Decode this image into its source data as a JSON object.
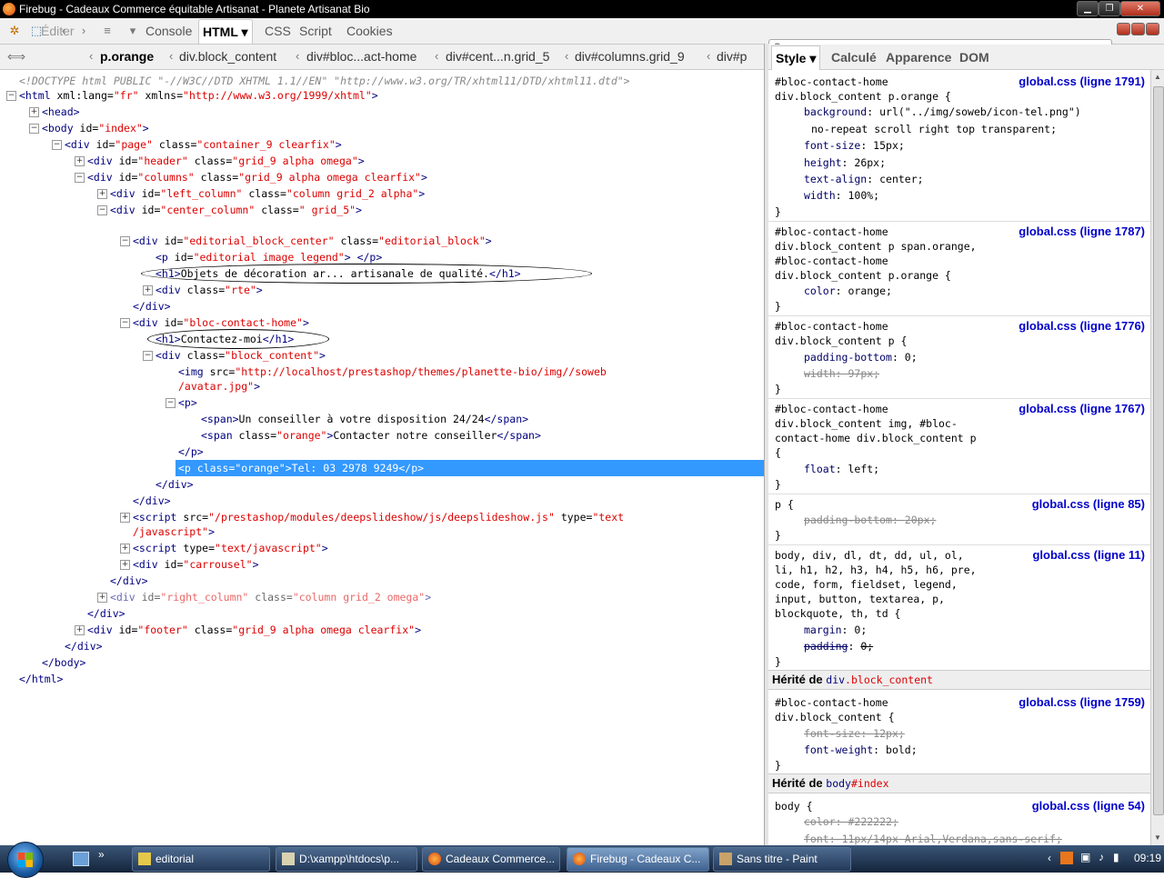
{
  "window": {
    "title": "Firebug - Cadeaux Commerce équitable Artisanat - Planete Artisanat Bio"
  },
  "toolbar": {
    "tabs": [
      {
        "label": "Éditer"
      },
      {
        "label": "Console"
      },
      {
        "label": "HTML ▾"
      },
      {
        "label": "CSS"
      },
      {
        "label": "Script"
      },
      {
        "label": "Cookies"
      }
    ]
  },
  "breadcrumb": [
    "p.orange",
    "div.block_content",
    "div#bloc...act-home",
    "div#cent...n.grid_5",
    "div#columns.grid_9",
    "div#p"
  ],
  "html": {
    "doctype": "<!DOCTYPE html PUBLIC \"-//W3C//DTD XHTML 1.1//EN\" \"http://www.w3.org/TR/xhtml11/DTD/xhtml11.dtd\">",
    "lines": [
      [
        "<html ",
        "xml:lang=",
        "\"fr\"",
        " xmlns=",
        "\"http://www.w3.org/1999/xhtml\"",
        ">"
      ],
      [
        "<head>"
      ],
      [
        "<body ",
        "id=",
        "\"index\"",
        ">"
      ],
      [
        "<div ",
        "id=",
        "\"page\"",
        " class=",
        "\"container_9 clearfix\"",
        ">"
      ],
      [
        "<div ",
        "id=",
        "\"header\"",
        " class=",
        "\"grid_9 alpha omega\"",
        ">"
      ],
      [
        "<div ",
        "id=",
        "\"columns\"",
        " class=",
        "\"grid_9 alpha omega clearfix\"",
        ">"
      ],
      [
        "<div ",
        "id=",
        "\"left_column\"",
        " class=",
        "\"column grid_2 alpha\"",
        ">"
      ],
      [
        "<div ",
        "id=",
        "\"center_column\"",
        " class=",
        "\" grid_5\"",
        ">"
      ],
      [
        "<div ",
        "id=",
        "\"editorial_block_center\"",
        " class=",
        "\"editorial_block\"",
        ">"
      ],
      [
        "<p ",
        "id=",
        "\"editorial image legend\"",
        ">  </p>"
      ],
      [
        "<h1>",
        "Objets de décoration ar... artisanale de qualité.",
        "</h1>"
      ],
      [
        "<div ",
        "class=",
        "\"rte\"",
        ">"
      ],
      [
        "</div>"
      ],
      [
        "<div ",
        "id=",
        "\"bloc-contact-home\"",
        ">"
      ],
      [
        "<h1>",
        "Contactez-moi",
        "</h1>"
      ],
      [
        "<div ",
        "class=",
        "\"block_content\"",
        ">"
      ],
      [
        "<img ",
        "src=",
        "\"http://localhost/prestashop/themes/planette-bio/img//soweb"
      ],
      [
        "/avatar.jpg\"",
        ">"
      ],
      [
        "<p>"
      ],
      [
        "<span>",
        "Un conseiller à votre disposition 24/24",
        "</span>"
      ],
      [
        "<span ",
        "class=",
        "\"orange\"",
        ">",
        "Contacter notre conseiller",
        "</span>"
      ],
      [
        "</p>"
      ],
      [
        "<p ",
        "class=",
        "\"orange\"",
        ">",
        "Tel: 03 2978 9249",
        "</p>"
      ],
      [
        "</div>"
      ],
      [
        "</div>"
      ],
      [
        "<script ",
        "src=",
        "\"/prestashop/modules/deepslideshow/js/deepslideshow.js\"",
        " type=",
        "\"text"
      ],
      [
        "/javascript\"",
        ">"
      ],
      [
        "<script ",
        "type=",
        "\"text/javascript\"",
        ">"
      ],
      [
        "<div ",
        "id=",
        "\"carrousel\"",
        ">"
      ],
      [
        "</div>"
      ],
      [
        "<div ",
        "id=",
        "\"right_column\"",
        " class=",
        "\"column grid_2 omega\"",
        ">"
      ],
      [
        "</div>"
      ],
      [
        "<div ",
        "id=",
        "\"footer\"",
        " class=",
        "\"grid_9 alpha omega clearfix\"",
        ">"
      ],
      [
        "</div>"
      ],
      [
        "</body>"
      ],
      [
        "</html>"
      ]
    ]
  },
  "sidepanel": {
    "tabs": [
      "Style ▾",
      "Calculé",
      "Apparence",
      "DOM"
    ]
  },
  "styles": {
    "rules": [
      {
        "selector": [
          "#bloc-contact-home",
          "div.block_content p.orange {"
        ],
        "source": "global.css (ligne 1791)",
        "props": [
          {
            "p": "background",
            "v": "url(\"../img/soweb/icon-tel.png\")",
            "cont": "no-repeat scroll right top transparent;",
            "s": false
          },
          {
            "p": "font-size",
            "v": "15px;",
            "s": false
          },
          {
            "p": "height",
            "v": "26px;",
            "s": false
          },
          {
            "p": "text-align",
            "v": "center;",
            "s": false
          },
          {
            "p": "width",
            "v": "100%;",
            "s": false
          }
        ]
      },
      {
        "selector": [
          "#bloc-contact-home",
          "div.block_content p span.orange,",
          "#bloc-contact-home",
          "div.block_content p.orange {"
        ],
        "source": "global.css (ligne 1787)",
        "props": [
          {
            "p": "color",
            "v": "orange;",
            "s": false
          }
        ]
      },
      {
        "selector": [
          "#bloc-contact-home",
          "div.block_content p {"
        ],
        "source": "global.css (ligne 1776)",
        "props": [
          {
            "p": "padding-bottom",
            "v": "0;",
            "s": false
          },
          {
            "p": "width",
            "v": "97px;",
            "s": true
          }
        ]
      },
      {
        "selector": [
          "#bloc-contact-home",
          "div.block_content img, #bloc-",
          "contact-home div.block_content p",
          "{"
        ],
        "source": "global.css (ligne 1767)",
        "props": [
          {
            "p": "float",
            "v": "left;",
            "s": false
          }
        ]
      },
      {
        "selector": [
          "p {"
        ],
        "source": "global.css (ligne 85)",
        "props": [
          {
            "p": "padding-bottom",
            "v": "20px;",
            "s": true
          }
        ]
      },
      {
        "selector": [
          "body, div, dl, dt, dd, ul, ol,",
          "li, h1, h2, h3, h4, h5, h6, pre,",
          "code, form, fieldset, legend,",
          "input, button, textarea, p,",
          "blockquote, th, td {"
        ],
        "source": "global.css (ligne 11)",
        "props": [
          {
            "p": "margin",
            "v": "0;",
            "s": false
          },
          {
            "p": "padding",
            "v": "0;",
            "s": true
          }
        ]
      }
    ],
    "inherited1": {
      "label": "Hérité de",
      "tag": "div",
      "cls": ".block_content"
    },
    "rule7": {
      "selector": [
        "#bloc-contact-home",
        "div.block_content {"
      ],
      "source": "global.css (ligne 1759)",
      "props": [
        {
          "p": "font-size",
          "v": "12px;",
          "s": true
        },
        {
          "p": "font-weight",
          "v": "bold;",
          "s": false
        }
      ]
    },
    "inherited2": {
      "label": "Hérité de",
      "tag": "body",
      "cls": "#index"
    },
    "rule8": {
      "selector": [
        "body {"
      ],
      "source": "global.css (ligne 54)",
      "props": [
        {
          "p": "color",
          "v": "#222222;",
          "s": true
        },
        {
          "p": "font",
          "v": "11px/14px Arial,Verdana,sans-serif;",
          "s": true
        }
      ]
    },
    "close": "}"
  },
  "taskbar": {
    "items": [
      {
        "label": "editorial"
      },
      {
        "label": "D:\\xampp\\htdocs\\p..."
      },
      {
        "label": "Cadeaux Commerce..."
      },
      {
        "label": "Firebug - Cadeaux C..."
      },
      {
        "label": "Sans titre - Paint"
      }
    ],
    "clock": "09:19"
  },
  "colors": {
    "accent": "#3399ff",
    "tag": "#000080",
    "value": "#dd0000",
    "link": "#0000cc"
  }
}
